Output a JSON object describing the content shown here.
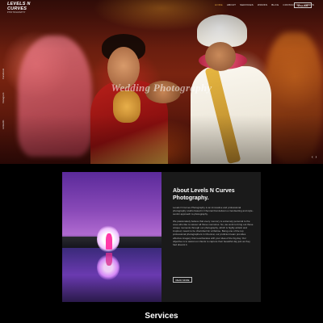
{
  "nav": {
    "logo_main": "LEVELS N CURVES",
    "logo_sub": "PHOTOGRAPHY",
    "menu": [
      "HOME",
      "ABOUT",
      "SERVICES",
      "WORKS",
      "BLOG",
      "CONTACT US",
      "VIDEOS"
    ],
    "enquire_label": "ENQUIRE"
  },
  "hero": {
    "title": "Wedding Photography",
    "social": [
      "Facebook",
      "Instagram",
      "LinkedIn"
    ],
    "prev_arrow": "‹",
    "next_arrow": "›"
  },
  "about": {
    "title": "About Levels N Curves Photography.",
    "paragraph1": "Levels N Curves Photography is an innovative and professional photography studio based in Chennai that delivers a trendsetting and style-centric approach to photography.",
    "paragraph2": "We passionately believe that every memory is extremely personal to the ones who like to savour all those memories. So, we work to bring out those unique moments through our photography, which is highly artistic and inspired, meant to be cherished for a lifetime. Being one of the top professional photographers in Chennai, our proficient team provides effective imagery that reverberates with your idea of the big day. Our objective is to assist our clients to capture their beautiful day just as they had dreamt it.",
    "read_more_label": "READ MORE"
  },
  "services": {
    "title": "Services"
  }
}
